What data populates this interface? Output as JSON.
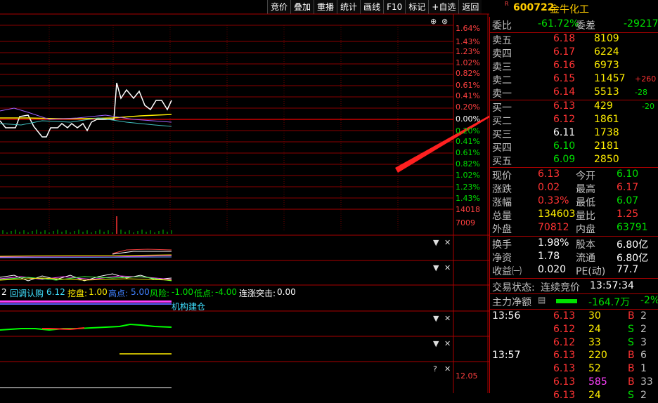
{
  "toolbar": [
    "竞价",
    "叠加",
    "重播",
    "统计",
    "画线",
    "F10",
    "标记",
    "+自选",
    "返回"
  ],
  "stock": {
    "flag": "R",
    "code": "600722",
    "name": "金牛化工"
  },
  "price_axis": [
    "1.64%",
    "1.43%",
    "1.23%",
    "1.02%",
    "0.82%",
    "0.61%",
    "0.41%",
    "0.20%",
    "0.00%",
    "0.20%",
    "0.41%",
    "0.61%",
    "0.82%",
    "1.02%",
    "1.23%",
    "1.43%"
  ],
  "volume_axis": [
    "14018",
    "7009"
  ],
  "bottom_axis": "12.05",
  "indicator_line": {
    "prefix": "2",
    "name": "回调认购",
    "name_val": "6.12",
    "items": [
      {
        "label": "挖盘:",
        "value": "1.00"
      },
      {
        "label": "高点:",
        "value": "5.00"
      },
      {
        "label": "风险:",
        "value": "-1.00"
      },
      {
        "label": "低点:",
        "value": "-4.00"
      },
      {
        "label": "连涨突击:",
        "value": "0.00"
      }
    ],
    "tag": "机构建仓"
  },
  "weibi": {
    "label": "委比",
    "value": "-61.72%",
    "label2": "委差",
    "value2": "-29217"
  },
  "asks": [
    {
      "label": "卖五",
      "price": "6.18",
      "vol": "8109",
      "chg": ""
    },
    {
      "label": "卖四",
      "price": "6.17",
      "vol": "6224",
      "chg": ""
    },
    {
      "label": "卖三",
      "price": "6.16",
      "vol": "6973",
      "chg": ""
    },
    {
      "label": "卖二",
      "price": "6.15",
      "vol": "11457",
      "chg": "+260"
    },
    {
      "label": "卖一",
      "price": "6.14",
      "vol": "5513",
      "chg": "-28"
    }
  ],
  "bids": [
    {
      "label": "买一",
      "price": "6.13",
      "vol": "429",
      "chg": "-20"
    },
    {
      "label": "买二",
      "price": "6.12",
      "vol": "1861",
      "chg": ""
    },
    {
      "label": "买三",
      "price": "6.11",
      "vol": "1738",
      "chg": ""
    },
    {
      "label": "买四",
      "price": "6.10",
      "vol": "2181",
      "chg": ""
    },
    {
      "label": "买五",
      "price": "6.09",
      "vol": "2850",
      "chg": ""
    }
  ],
  "quote": [
    {
      "l1": "现价",
      "v1": "6.13",
      "l2": "今开",
      "v2": "6.10"
    },
    {
      "l1": "涨跌",
      "v1": "0.02",
      "l2": "最高",
      "v2": "6.17"
    },
    {
      "l1": "涨幅",
      "v1": "0.33%",
      "l2": "最低",
      "v2": "6.07"
    },
    {
      "l1": "总量",
      "v1": "134603",
      "l2": "量比",
      "v2": "1.25"
    },
    {
      "l1": "外盘",
      "v1": "70812",
      "l2": "内盘",
      "v2": "63791"
    }
  ],
  "stats": [
    {
      "l1": "换手",
      "v1": "1.98%",
      "l2": "股本",
      "v2": "6.80亿"
    },
    {
      "l1": "净资",
      "v1": "1.78",
      "l2": "流通",
      "v2": "6.80亿"
    },
    {
      "l1": "收益㈠",
      "v1": "0.020",
      "l2": "PE(动)",
      "v2": "77.7"
    }
  ],
  "trade_status": {
    "label": "交易状态:",
    "value": "连续竞价",
    "time": "13:57:34"
  },
  "main_flow": {
    "label": "主力净额",
    "value": "-164.7万",
    "pct": "-2%"
  },
  "ticks": [
    {
      "time": "13:56",
      "price": "6.13",
      "vol": "30",
      "side": "B",
      "n": "2"
    },
    {
      "time": "",
      "price": "6.12",
      "vol": "24",
      "side": "S",
      "n": "2"
    },
    {
      "time": "",
      "price": "6.12",
      "vol": "33",
      "side": "S",
      "n": "3"
    },
    {
      "time": "13:57",
      "price": "6.13",
      "vol": "220",
      "side": "B",
      "n": "6"
    },
    {
      "time": "",
      "price": "6.13",
      "vol": "52",
      "side": "B",
      "n": "1"
    },
    {
      "time": "",
      "price": "6.13",
      "vol": "585",
      "side": "B",
      "n": "33"
    },
    {
      "time": "",
      "price": "6.13",
      "vol": "24",
      "side": "S",
      "n": "2"
    }
  ]
}
